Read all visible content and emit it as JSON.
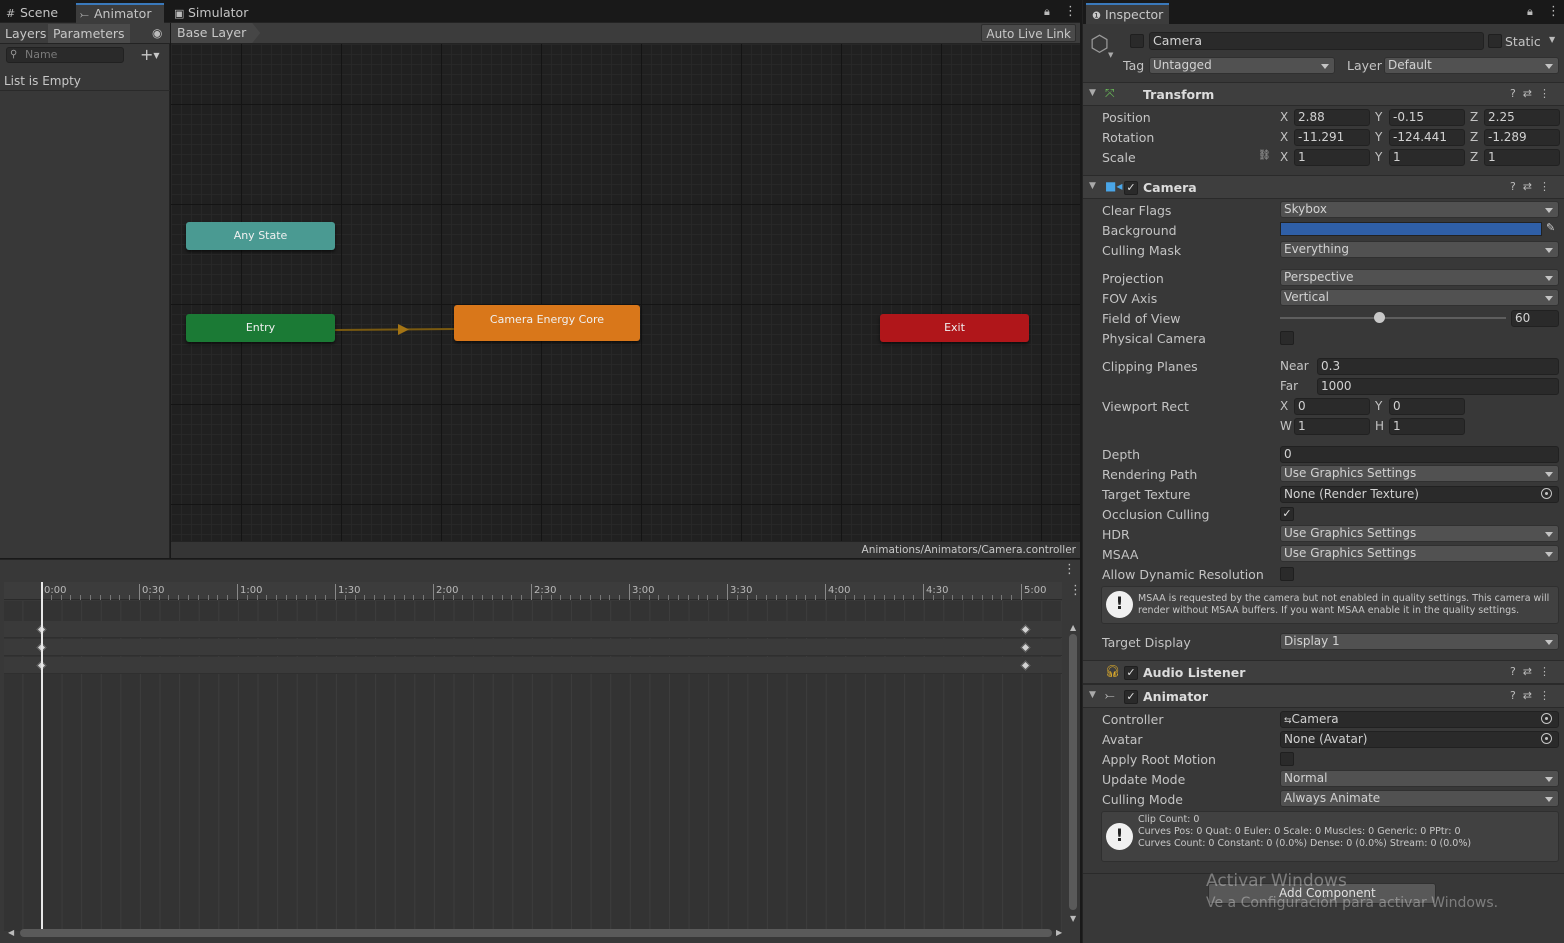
{
  "tabs": {
    "scene": "Scene",
    "animator": "Animator",
    "simulator": "Simulator",
    "inspector": "Inspector"
  },
  "animator": {
    "subtabs": {
      "layers": "Layers",
      "parameters": "Parameters"
    },
    "search_placeholder": "Name",
    "list_empty": "List is Empty",
    "breadcrumb": "Base Layer",
    "auto_live_link": "Auto Live Link",
    "path": "Animations/Animators/Camera.controller",
    "nodes": {
      "any_state": "Any State",
      "entry": "Entry",
      "default_state": "Camera Energy Core",
      "exit": "Exit"
    },
    "colors": {
      "any_state": "#4a9a92",
      "entry": "#1b7a35",
      "default_state": "#d9771a",
      "exit": "#b0161a"
    }
  },
  "timeline": {
    "ticks": [
      "0:00",
      "0:30",
      "1:00",
      "1:30",
      "2:00",
      "2:30",
      "3:00",
      "3:30",
      "4:00",
      "4:30",
      "5:00"
    ]
  },
  "inspector": {
    "object_name": "Camera",
    "static_label": "Static",
    "tag_label": "Tag",
    "tag_value": "Untagged",
    "layer_label": "Layer",
    "layer_value": "Default",
    "transform": {
      "title": "Transform",
      "position_label": "Position",
      "position": {
        "x": "2.88",
        "y": "-0.15",
        "z": "2.25"
      },
      "rotation_label": "Rotation",
      "rotation": {
        "x": "-11.291",
        "y": "-124.441",
        "z": "-1.289"
      },
      "scale_label": "Scale",
      "scale": {
        "x": "1",
        "y": "1",
        "z": "1"
      }
    },
    "camera": {
      "title": "Camera",
      "clear_flags_label": "Clear Flags",
      "clear_flags": "Skybox",
      "background_label": "Background",
      "background_color": "#2f5fa7",
      "culling_mask_label": "Culling Mask",
      "culling_mask": "Everything",
      "projection_label": "Projection",
      "projection": "Perspective",
      "fov_axis_label": "FOV Axis",
      "fov_axis": "Vertical",
      "fov_label": "Field of View",
      "fov": "60",
      "fov_fraction": 0.44,
      "physical_label": "Physical Camera",
      "clipping_label": "Clipping Planes",
      "near_label": "Near",
      "near": "0.3",
      "far_label": "Far",
      "far": "1000",
      "viewport_label": "Viewport Rect",
      "vp_x": "0",
      "vp_y": "0",
      "vp_w": "1",
      "vp_h": "1",
      "depth_label": "Depth",
      "depth": "0",
      "rendering_path_label": "Rendering Path",
      "rendering_path": "Use Graphics Settings",
      "target_texture_label": "Target Texture",
      "target_texture": "None (Render Texture)",
      "occlusion_label": "Occlusion Culling",
      "hdr_label": "HDR",
      "hdr": "Use Graphics Settings",
      "msaa_label": "MSAA",
      "msaa": "Use Graphics Settings",
      "dynres_label": "Allow Dynamic Resolution",
      "msaa_warning_1": "MSAA is requested by the camera but not enabled in quality settings. This camera will",
      "msaa_warning_2": "render without MSAA buffers. If you want MSAA enable it in the quality settings.",
      "target_display_label": "Target Display",
      "target_display": "Display 1"
    },
    "audio_listener": {
      "title": "Audio Listener"
    },
    "animator_comp": {
      "title": "Animator",
      "controller_label": "Controller",
      "controller": "Camera",
      "avatar_label": "Avatar",
      "avatar": "None (Avatar)",
      "root_motion_label": "Apply Root Motion",
      "update_mode_label": "Update Mode",
      "update_mode": "Normal",
      "culling_mode_label": "Culling Mode",
      "culling_mode": "Always Animate",
      "info_1": "Clip Count: 0",
      "info_2": "Curves Pos: 0 Quat: 0 Euler: 0 Scale: 0 Muscles: 0 Generic: 0 PPtr: 0",
      "info_3": "Curves Count: 0 Constant: 0 (0.0%) Dense: 0 (0.0%) Stream: 0 (0.0%)"
    },
    "add_component": "Add Component"
  },
  "watermark": {
    "line1": "Activar Windows",
    "line2": "Ve a Configuración para activar Windows."
  }
}
